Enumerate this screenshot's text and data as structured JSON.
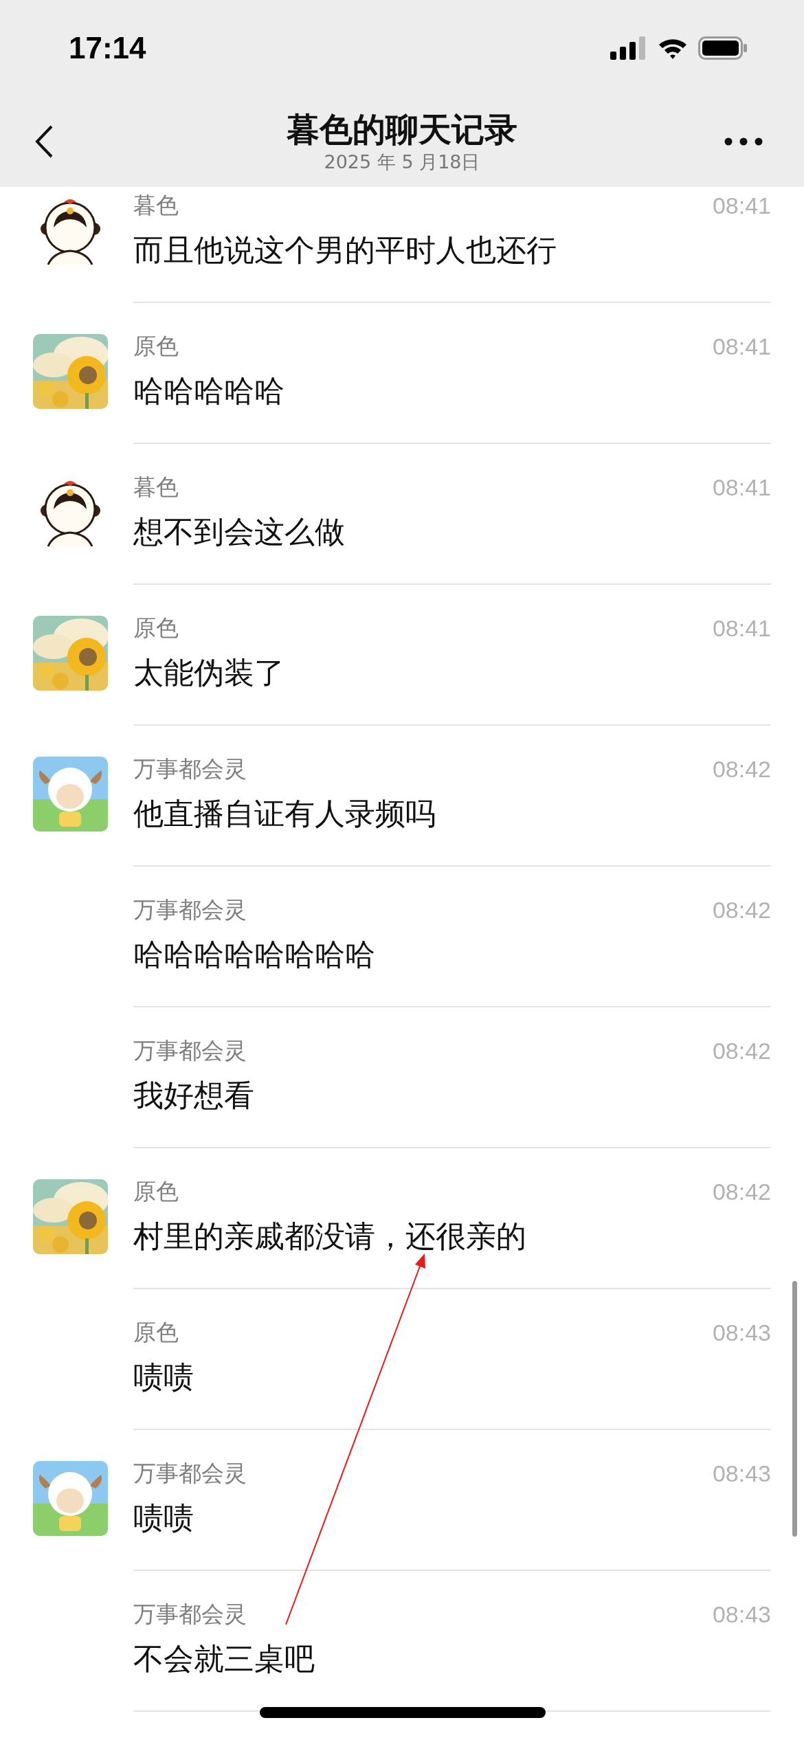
{
  "status_bar": {
    "time": "17:14"
  },
  "nav": {
    "title": "暮色的聊天记录",
    "date": "2025 年 5 月18日"
  },
  "messages": [
    {
      "kind": "girl",
      "sender": "暮色",
      "time": "08:41",
      "text": "而且他说这个男的平时人也还行"
    },
    {
      "kind": "sunflower",
      "sender": "原色",
      "time": "08:41",
      "text": "哈哈哈哈哈"
    },
    {
      "kind": "girl",
      "sender": "暮色",
      "time": "08:41",
      "text": "想不到会这么做"
    },
    {
      "kind": "sunflower",
      "sender": "原色",
      "time": "08:41",
      "text": "太能伪装了"
    },
    {
      "kind": "sheep",
      "sender": "万事都会灵",
      "time": "08:42",
      "text": "他直播自证有人录频吗"
    },
    {
      "kind": "plain",
      "sender": "万事都会灵",
      "time": "08:42",
      "text": "哈哈哈哈哈哈哈哈"
    },
    {
      "kind": "plain",
      "sender": "万事都会灵",
      "time": "08:42",
      "text": "我好想看"
    },
    {
      "kind": "sunflower",
      "sender": "原色",
      "time": "08:42",
      "text": "村里的亲戚都没请，还很亲的"
    },
    {
      "kind": "plain",
      "sender": "原色",
      "time": "08:43",
      "text": "啧啧"
    },
    {
      "kind": "sheep",
      "sender": "万事都会灵",
      "time": "08:43",
      "text": "啧啧"
    },
    {
      "kind": "plain",
      "sender": "万事都会灵",
      "time": "08:43",
      "text": "不会就三桌吧"
    }
  ]
}
